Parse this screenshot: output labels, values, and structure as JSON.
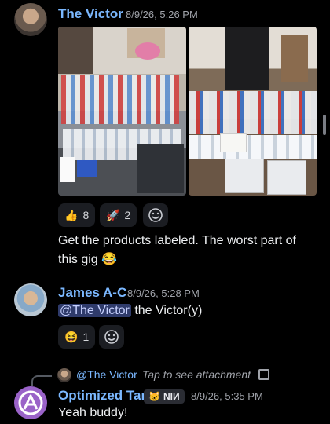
{
  "messages": [
    {
      "author": "The Victor",
      "timestamp": "8/9/26, 5:26 PM",
      "text": "Get the products labeled. The worst part of this gig 😂",
      "reactions": [
        {
          "emoji": "👍",
          "count": "8"
        },
        {
          "emoji": "🚀",
          "count": "2"
        }
      ]
    },
    {
      "author": "James A-C",
      "timestamp": "8/9/26, 5:28 PM",
      "mention": "@The Victor",
      "text_after_mention": " the Victor(y)",
      "reactions": [
        {
          "emoji": "😆",
          "count": "1"
        }
      ]
    },
    {
      "author": "Optimized Tank",
      "badge_emoji": "🐱",
      "badge_text": "NIИ",
      "timestamp": "8/9/26, 5:35 PM",
      "text": "Yeah buddy!",
      "reply": {
        "author": "@The Victor",
        "text": "Tap to see attachment"
      }
    }
  ],
  "icons": {
    "add_reaction": "smile-plus-icon",
    "attachment": "image-icon"
  }
}
